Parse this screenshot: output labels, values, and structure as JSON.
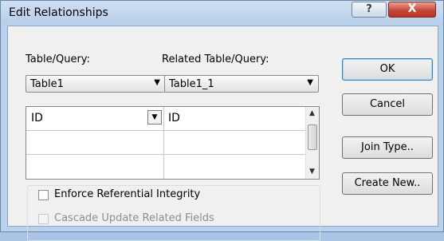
{
  "window": {
    "title": "Edit Relationships",
    "help_glyph": "?",
    "close_glyph": "X"
  },
  "table_query": {
    "label": "Table/Query:",
    "value": "Table1"
  },
  "related_table_query": {
    "label": "Related Table/Query:",
    "value": "Table1_1"
  },
  "fields_grid": {
    "rows": [
      {
        "left": "ID",
        "right": "ID"
      },
      {
        "left": "",
        "right": ""
      },
      {
        "left": "",
        "right": ""
      }
    ]
  },
  "buttons": {
    "ok": "OK",
    "cancel": "Cancel",
    "join_type": "Join Type..",
    "create_new": "Create New.."
  },
  "options": {
    "enforce_referential_integrity": {
      "label": "Enforce Referential Integrity",
      "checked": false
    },
    "cascade_update": {
      "label": "Cascade Update Related Fields",
      "checked": false,
      "enabled": false
    }
  },
  "colors": {
    "title_bar": "#b9d1ea",
    "close_button": "#c9473a",
    "dialog_face": "#f0f0f0"
  }
}
